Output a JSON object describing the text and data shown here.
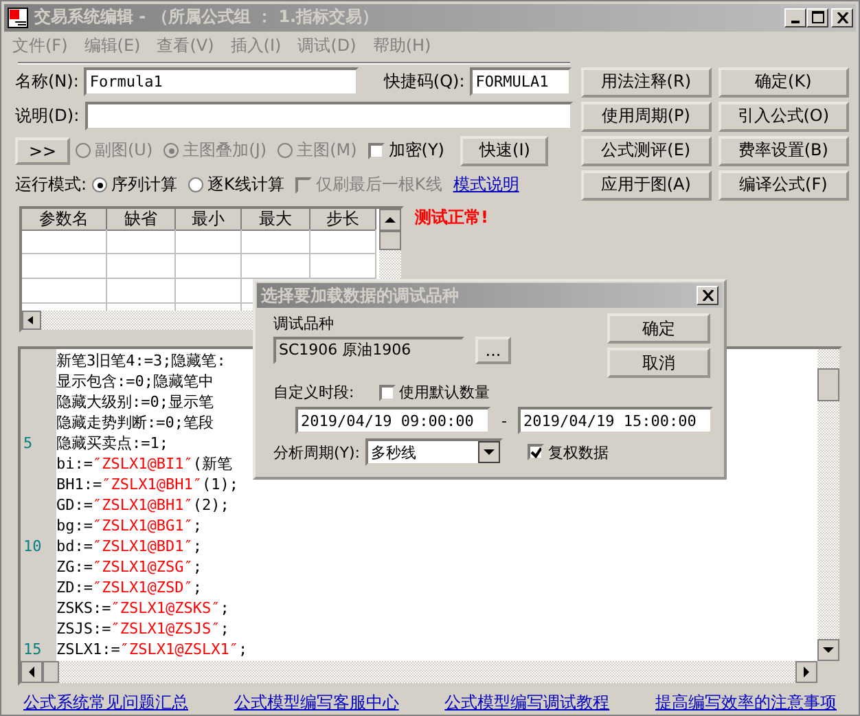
{
  "window": {
    "title": "交易系统编辑 - （所属公式组 ： 1.指标交易）"
  },
  "menu": [
    {
      "label": "文件(F)",
      "disabled": true
    },
    {
      "label": "编辑(E)",
      "disabled": true
    },
    {
      "label": "查看(V)",
      "disabled": true
    },
    {
      "label": "插入(I)",
      "disabled": true
    },
    {
      "label": "调试(D)",
      "disabled": true
    },
    {
      "label": "帮助(H)",
      "disabled": true
    }
  ],
  "form": {
    "name": {
      "label": "名称(N):",
      "value": "Formula1"
    },
    "shortcut": {
      "label": "快捷码(Q):",
      "value": "FORMULA1"
    },
    "description": {
      "label": "说明(D):"
    },
    "expand_button": ">>",
    "display_modes": [
      {
        "label": "副图(U)",
        "selected": false,
        "disabled": true
      },
      {
        "label": "主图叠加(J)",
        "selected": true,
        "disabled": true
      },
      {
        "label": "主图(M)",
        "selected": false,
        "disabled": true
      }
    ],
    "encrypt": {
      "label": "加密(Y)",
      "checked": false
    },
    "quick_button": "快速(I)",
    "run_mode": {
      "label": "运行模式:",
      "options": [
        {
          "label": "序列计算",
          "selected": true
        },
        {
          "label": "逐K线计算",
          "selected": false
        }
      ],
      "refresh_last": {
        "label": "仅刷最后一根K线",
        "checked": false,
        "disabled": true
      },
      "help_link": "模式说明"
    }
  },
  "buttons": [
    "用法注释(R)",
    "确定(K)",
    "使用周期(P)",
    "引入公式(O)",
    "公式测评(E)",
    "费率设置(B)",
    "应用于图(A)",
    "编译公式(F)"
  ],
  "params_table": {
    "columns": [
      "参数名",
      "缺省",
      "最小",
      "最大",
      "步长"
    ]
  },
  "status_message": "测试正常!",
  "editor": {
    "lines": [
      {
        "parts": [
          {
            "kind": "plain",
            "text": "新笔3旧笔4:=3;隐藏笔:"
          }
        ]
      },
      {
        "parts": [
          {
            "kind": "plain",
            "text": "显示包含:=0;隐藏笔中"
          }
        ]
      },
      {
        "parts": [
          {
            "kind": "plain",
            "text": "隐藏大级别:=0;显示笔"
          }
        ]
      },
      {
        "parts": [
          {
            "kind": "plain",
            "text": "隐藏走势判断:=0;笔段"
          }
        ]
      },
      {
        "number": "5",
        "parts": [
          {
            "kind": "plain",
            "text": "隐藏买卖点:=1;"
          }
        ]
      },
      {
        "parts": [
          {
            "kind": "plain",
            "text": "bi:="
          },
          {
            "kind": "string",
            "text": "″ZSLX1@BI1″"
          },
          {
            "kind": "plain",
            "text": "(新笔"
          }
        ]
      },
      {
        "parts": [
          {
            "kind": "plain",
            "text": "BH1:="
          },
          {
            "kind": "string",
            "text": "″ZSLX1@BH1″"
          },
          {
            "kind": "plain",
            "text": "(1);"
          }
        ]
      },
      {
        "parts": [
          {
            "kind": "plain",
            "text": "GD:="
          },
          {
            "kind": "string",
            "text": "″ZSLX1@BH1″"
          },
          {
            "kind": "plain",
            "text": "(2);"
          }
        ]
      },
      {
        "parts": [
          {
            "kind": "plain",
            "text": "bg:="
          },
          {
            "kind": "string",
            "text": "″ZSLX1@BG1″"
          },
          {
            "kind": "plain",
            "text": ";"
          }
        ]
      },
      {
        "number": "10",
        "parts": [
          {
            "kind": "plain",
            "text": "bd:="
          },
          {
            "kind": "string",
            "text": "″ZSLX1@BD1″"
          },
          {
            "kind": "plain",
            "text": ";"
          }
        ]
      },
      {
        "parts": [
          {
            "kind": "plain",
            "text": "ZG:="
          },
          {
            "kind": "string",
            "text": "″ZSLX1@ZSG″"
          },
          {
            "kind": "plain",
            "text": ";"
          }
        ]
      },
      {
        "parts": [
          {
            "kind": "plain",
            "text": "ZD:="
          },
          {
            "kind": "string",
            "text": "″ZSLX1@ZSD″"
          },
          {
            "kind": "plain",
            "text": ";"
          }
        ]
      },
      {
        "parts": [
          {
            "kind": "plain",
            "text": "ZSKS:="
          },
          {
            "kind": "string",
            "text": "″ZSLX1@ZSKS″"
          },
          {
            "kind": "plain",
            "text": ";"
          }
        ]
      },
      {
        "parts": [
          {
            "kind": "plain",
            "text": "ZSJS:="
          },
          {
            "kind": "string",
            "text": "″ZSLX1@ZSJS″"
          },
          {
            "kind": "plain",
            "text": ";"
          }
        ]
      },
      {
        "number": "15",
        "parts": [
          {
            "kind": "plain",
            "text": "ZSLX1:="
          },
          {
            "kind": "string",
            "text": "″ZSLX1@ZSLX1″"
          },
          {
            "kind": "plain",
            "text": ";"
          }
        ]
      }
    ]
  },
  "links": [
    "公式系统常见问题汇总",
    "公式模型编写客服中心",
    "公式模型编写调试教程",
    "提高编写效率的注意事项"
  ],
  "dialog": {
    "title": "选择要加载数据的调试品种",
    "instrument_label": "调试品种",
    "instrument": "SC1906  原油1906",
    "browse_button": "...",
    "ok_button": "确定",
    "cancel_button": "取消",
    "custom_period": {
      "label": "自定义时段:"
    },
    "default_count": {
      "label": "使用默认数量",
      "checked": false
    },
    "start": "2019/04/19 09:00:00",
    "separator": "-",
    "end": "2019/04/19 15:00:00",
    "period": {
      "label": "分析周期(Y):",
      "value": "多秒线"
    },
    "adjusted": {
      "label": "复权数据",
      "checked": true
    }
  }
}
